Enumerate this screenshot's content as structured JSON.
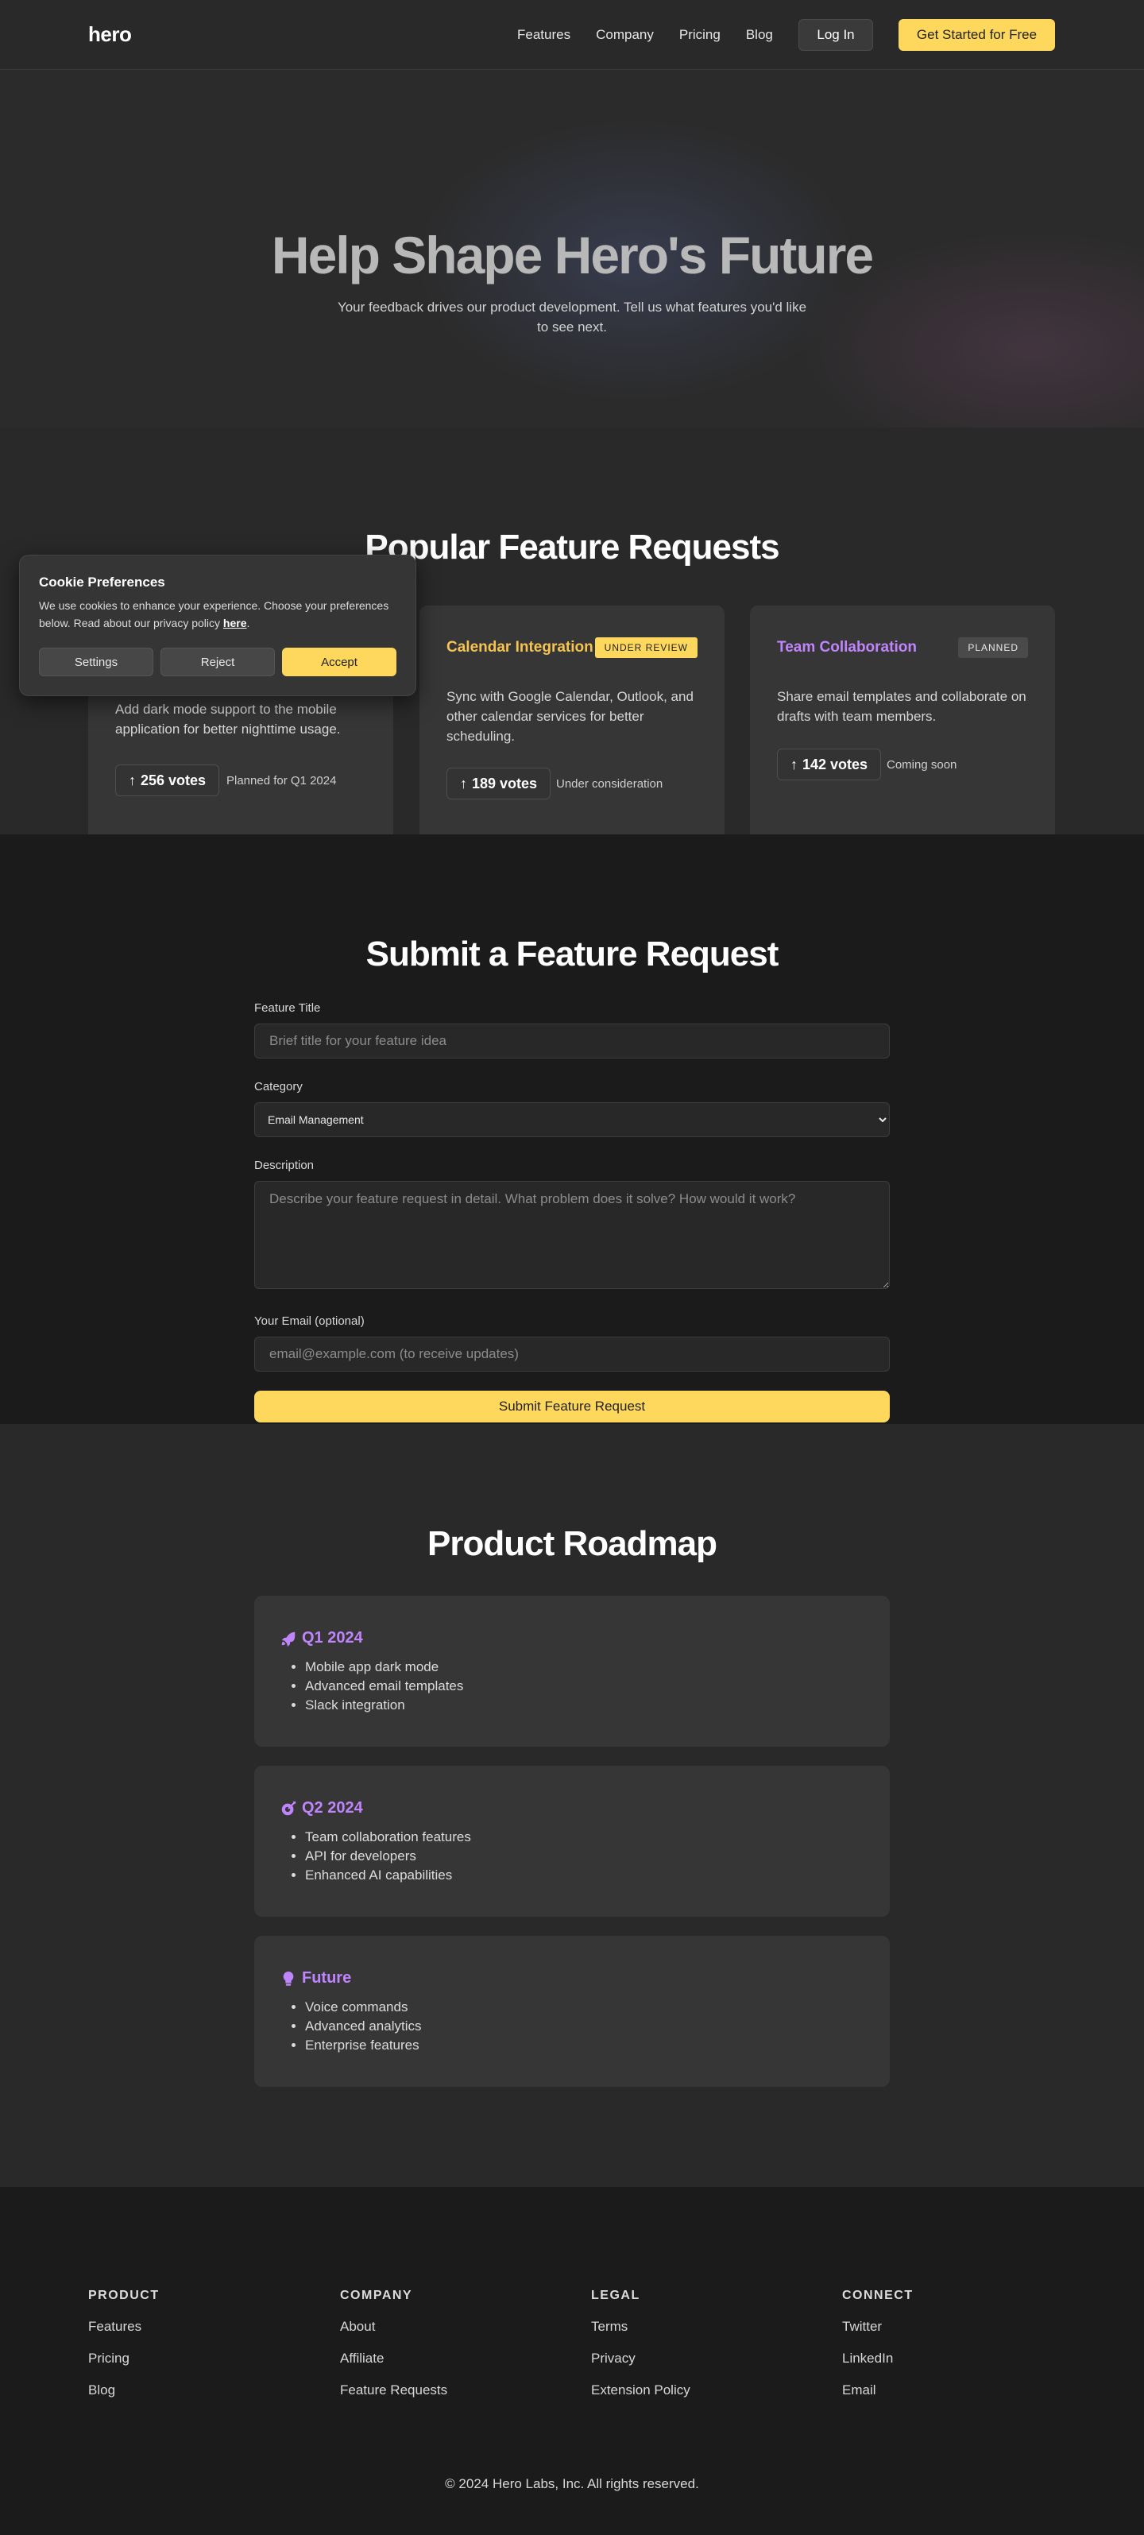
{
  "nav": {
    "logo": "hero",
    "links": [
      "Features",
      "Company",
      "Pricing",
      "Blog"
    ],
    "login": "Log In",
    "cta": "Get Started for Free"
  },
  "hero": {
    "title": "Help Shape Hero's Future",
    "subtitle": "Your feedback drives our product development. Tell us what features you'd like to see next."
  },
  "popular": {
    "title": "Popular Feature Requests",
    "cards": [
      {
        "title": "",
        "badge": "",
        "description": "Add dark mode support to the mobile application for better nighttime usage.",
        "votes": "256 votes",
        "status": "Planned for Q1 2024"
      },
      {
        "title": "Calendar Integration",
        "title_color": "#f5c451",
        "badge": "UNDER REVIEW",
        "description": "Sync with Google Calendar, Outlook, and other calendar services for better scheduling.",
        "votes": "189 votes",
        "status": "Under consideration"
      },
      {
        "title": "Team Collaboration",
        "title_color": "#c084fc",
        "badge": "PLANNED",
        "description": "Share email templates and collaborate on drafts with team members.",
        "votes": "142 votes",
        "status": "Coming soon"
      }
    ]
  },
  "cookie": {
    "title": "Cookie Preferences",
    "text": "We use cookies to enhance your experience. Choose your preferences below. Read about our privacy policy ",
    "link": "here",
    "text_end": ".",
    "settings": "Settings",
    "reject": "Reject",
    "accept": "Accept"
  },
  "form": {
    "title": "Submit a Feature Request",
    "feature_title_label": "Feature Title",
    "feature_title_placeholder": "Brief title for your feature idea",
    "category_label": "Category",
    "category_value": "Email Management",
    "description_label": "Description",
    "description_placeholder": "Describe your feature request in detail. What problem does it solve? How would it work?",
    "email_label": "Your Email (optional)",
    "email_placeholder": "email@example.com (to receive updates)",
    "submit": "Submit Feature Request"
  },
  "roadmap": {
    "title": "Product Roadmap",
    "items": [
      {
        "icon": "rocket-icon",
        "title": "Q1 2024",
        "points": [
          "Mobile app dark mode",
          "Advanced email templates",
          "Slack integration"
        ]
      },
      {
        "icon": "target-icon",
        "title": "Q2 2024",
        "points": [
          "Team collaboration features",
          "API for developers",
          "Enhanced AI capabilities"
        ]
      },
      {
        "icon": "lightbulb-icon",
        "title": "Future",
        "points": [
          "Voice commands",
          "Advanced analytics",
          "Enterprise features"
        ]
      }
    ]
  },
  "footer": {
    "columns": [
      {
        "heading": "PRODUCT",
        "links": [
          "Features",
          "Pricing",
          "Blog"
        ]
      },
      {
        "heading": "COMPANY",
        "links": [
          "About",
          "Affiliate",
          "Feature Requests"
        ]
      },
      {
        "heading": "LEGAL",
        "links": [
          "Terms",
          "Privacy",
          "Extension Policy"
        ]
      },
      {
        "heading": "CONNECT",
        "links": [
          "Twitter",
          "LinkedIn",
          "Email"
        ]
      }
    ],
    "copyright": "© 2024 Hero Labs, Inc. All rights reserved."
  }
}
